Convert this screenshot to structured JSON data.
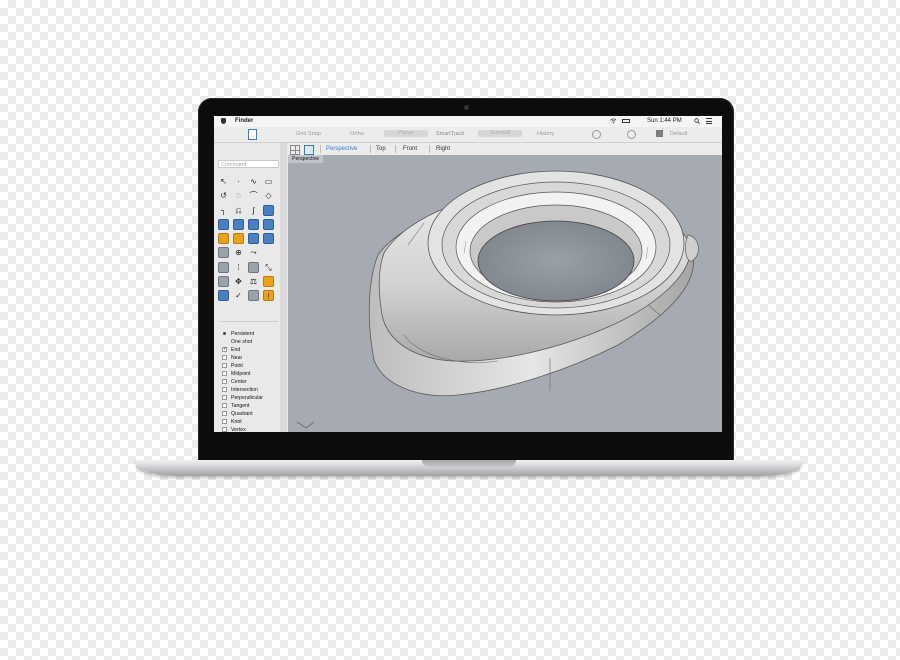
{
  "menubar": {
    "app_name": "Finder",
    "clock": "Sun 1:44 PM"
  },
  "toolbar": {
    "grid_snap": "Grid Snap",
    "ortho": "Ortho",
    "planar": "Planar",
    "smarttrack": "SmartTrack",
    "gumball": "Gumball",
    "history": "History",
    "default": "Default"
  },
  "left_panel": {
    "command_placeholder": "Command",
    "osnap": [
      {
        "label": "Persistent",
        "type": "radio",
        "checked": true
      },
      {
        "label": "One shot",
        "type": "radio",
        "checked": false
      },
      {
        "label": "End",
        "type": "check",
        "checked": true
      },
      {
        "label": "Near",
        "type": "check",
        "checked": false
      },
      {
        "label": "Point",
        "type": "check",
        "checked": false
      },
      {
        "label": "Midpoint",
        "type": "check",
        "checked": false
      },
      {
        "label": "Center",
        "type": "check",
        "checked": false
      },
      {
        "label": "Intersection",
        "type": "check",
        "checked": false
      },
      {
        "label": "Perpendicular",
        "type": "check",
        "checked": false
      },
      {
        "label": "Tangent",
        "type": "check",
        "checked": false
      },
      {
        "label": "Quadrant",
        "type": "check",
        "checked": false
      },
      {
        "label": "Knot",
        "type": "check",
        "checked": false
      },
      {
        "label": "Vertex",
        "type": "check",
        "checked": false
      },
      {
        "label": "On curve",
        "type": "check",
        "checked": false,
        "dim": true
      },
      {
        "label": "On surface",
        "type": "check",
        "checked": false,
        "dim": true
      },
      {
        "label": "On polysurface",
        "type": "check",
        "checked": false,
        "dim": true
      }
    ]
  },
  "viewport_tabs": [
    "Perspective",
    "Top",
    "Front",
    "Right"
  ],
  "viewport": {
    "title": "Perspective"
  },
  "colors": {
    "accent": "#2f7fd8",
    "viewport_bg": "#a6abb3",
    "model": "#d9d9d9"
  }
}
